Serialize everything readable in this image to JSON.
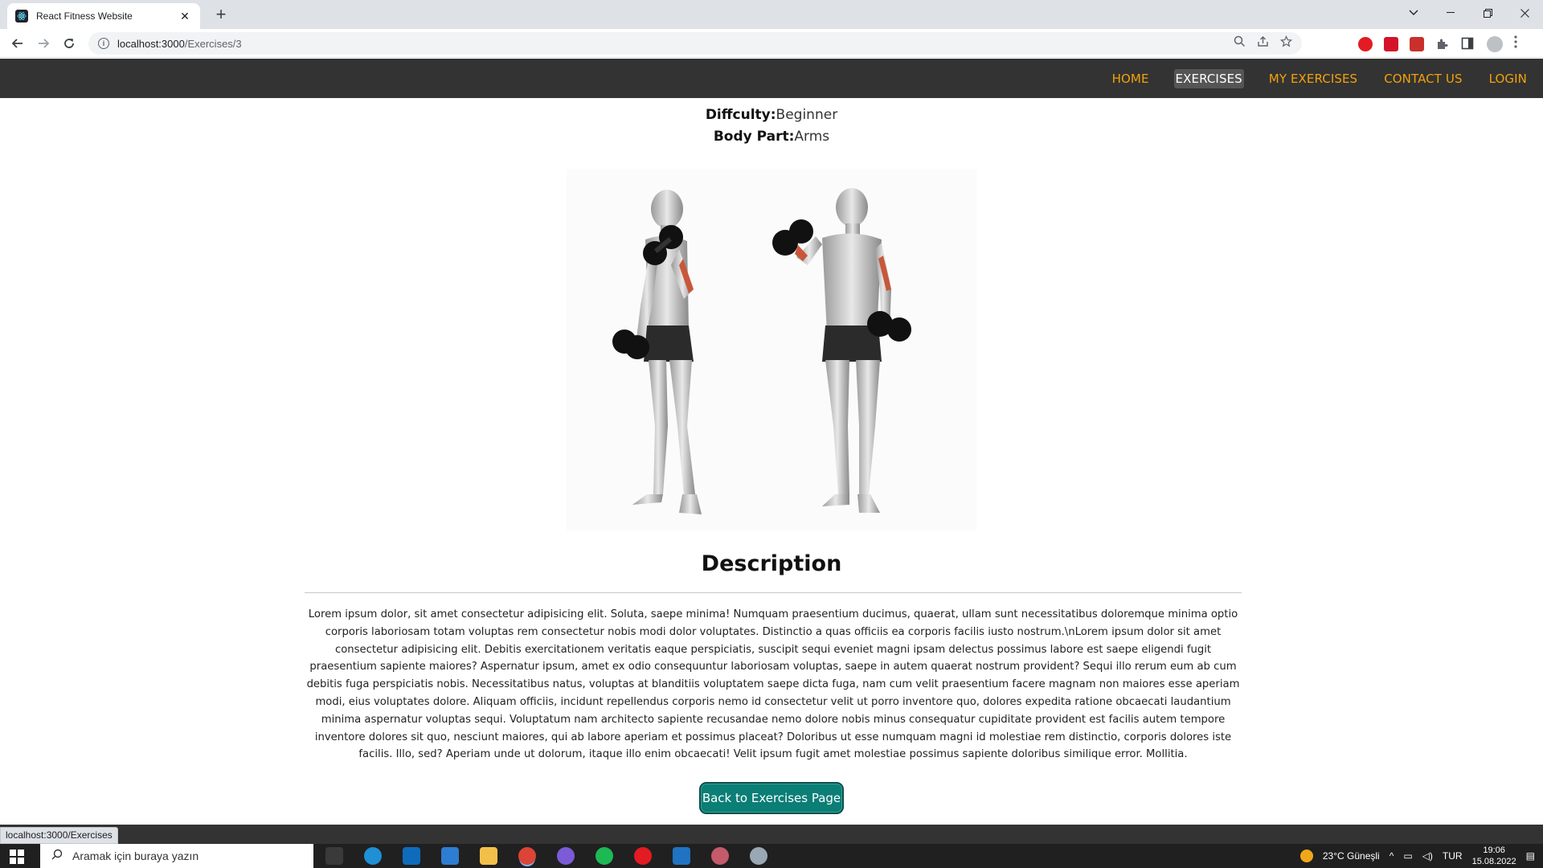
{
  "browser": {
    "tab_title": "React Fitness Website",
    "tab_close": "✕",
    "new_tab": "+",
    "url_host": "localhost:3000",
    "url_path": "/Exercises/3",
    "status_url": "localhost:3000/Exercises"
  },
  "navbar": {
    "links": [
      "HOME",
      "EXERCISES",
      "MY EXERCISES",
      "CONTACT US",
      "LOGIN"
    ],
    "active": "EXERCISES",
    "link_color": "#f2a20a",
    "bg_color": "#333333"
  },
  "exercise": {
    "difficulty_label": "Diffculty:",
    "difficulty_value": "Beginner",
    "bodypart_label": "Body Part:",
    "bodypart_value": "Arms",
    "image_alt": "dumbbell biceps curl illustration"
  },
  "description": {
    "heading": "Description",
    "text": "Lorem ipsum dolor, sit amet consectetur adipisicing elit. Soluta, saepe minima! Numquam praesentium ducimus, quaerat, ullam sunt necessitatibus doloremque minima optio corporis laboriosam totam voluptas rem consectetur nobis modi dolor voluptates. Distinctio a quas officiis ea corporis facilis iusto nostrum.\\nLorem ipsum dolor sit amet consectetur adipisicing elit. Debitis exercitationem veritatis eaque perspiciatis, suscipit sequi eveniet magni ipsam delectus possimus labore est saepe eligendi fugit praesentium sapiente maiores? Aspernatur ipsum, amet ex odio consequuntur laboriosam voluptas, saepe in autem quaerat nostrum provident? Sequi illo rerum eum ab cum debitis fuga perspiciatis nobis. Necessitatibus natus, voluptas at blanditiis voluptatem saepe dicta fuga, nam cum velit praesentium facere magnam non maiores esse aperiam modi, eius voluptates dolore. Aliquam officiis, incidunt repellendus corporis nemo id consectetur velit ut porro inventore quo, dolores expedita ratione obcaecati laudantium minima aspernatur voluptas sequi. Voluptatum nam architecto sapiente recusandae nemo dolore nobis minus consequatur cupiditate provident est facilis autem tempore inventore dolores sit quo, nesciunt maiores, qui ab labore aperiam et possimus placeat? Doloribus ut esse numquam magni id molestiae rem distinctio, corporis dolores iste facilis. Illo, sed? Aperiam unde ut dolorum, itaque illo enim obcaecati! Velit ipsum fugit amet molestiae possimus sapiente doloribus similique error. Mollitia."
  },
  "back_button": {
    "label": "Back to Exercises Page",
    "color": "#0b7e76"
  },
  "taskbar": {
    "search_placeholder": "Aramak için buraya yazın",
    "weather": "23°C  Güneşli",
    "language": "TUR",
    "time": "19:06",
    "date": "15.08.2022"
  }
}
